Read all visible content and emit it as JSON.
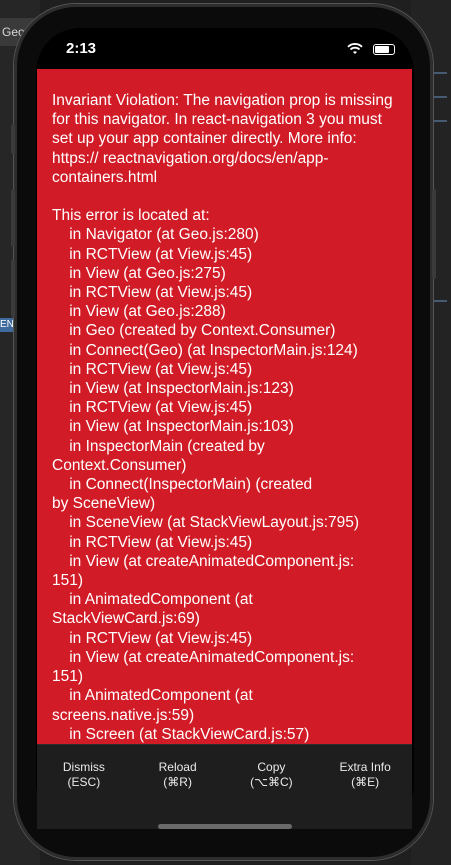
{
  "ide": {
    "tab_label": "Geo.j",
    "tag_label": "ENT"
  },
  "status_bar": {
    "time": "2:13",
    "icons": "ᯤ ◉"
  },
  "error": {
    "message": "Invariant Violation: The navigation prop is missing for this navigator. In react-navigation 3 you must set up your app container directly. More info: https:// reactnavigation.org/docs/en/app-containers.html\n\nThis error is located at:\n    in Navigator (at Geo.js:280)\n    in RCTView (at View.js:45)\n    in View (at Geo.js:275)\n    in RCTView (at View.js:45)\n    in View (at Geo.js:288)\n    in Geo (created by Context.Consumer)\n    in Connect(Geo) (at InspectorMain.js:124)\n    in RCTView (at View.js:45)\n    in View (at InspectorMain.js:123)\n    in RCTView (at View.js:45)\n    in View (at InspectorMain.js:103)\n    in InspectorMain (created by\nContext.Consumer)\n    in Connect(InspectorMain) (created\nby SceneView)\n    in SceneView (at StackViewLayout.js:795)\n    in RCTView (at View.js:45)\n    in View (at createAnimatedComponent.js:\n151)\n    in AnimatedComponent (at\nStackViewCard.js:69)\n    in RCTView (at View.js:45)\n    in View (at createAnimatedComponent.js:\n151)\n    in AnimatedComponent (at\nscreens.native.js:59)\n    in Screen (at StackViewCard.js:57)"
  },
  "toolbar": {
    "dismiss": {
      "label": "Dismiss",
      "shortcut": "(ESC)"
    },
    "reload": {
      "label": "Reload",
      "shortcut": "(⌘R)"
    },
    "copy": {
      "label": "Copy",
      "shortcut": "(⌥⌘C)"
    },
    "extra": {
      "label": "Extra Info",
      "shortcut": "(⌘E)"
    }
  },
  "colors": {
    "error_background": "#d11b26",
    "toolbar_background": "#1e1e1e"
  }
}
